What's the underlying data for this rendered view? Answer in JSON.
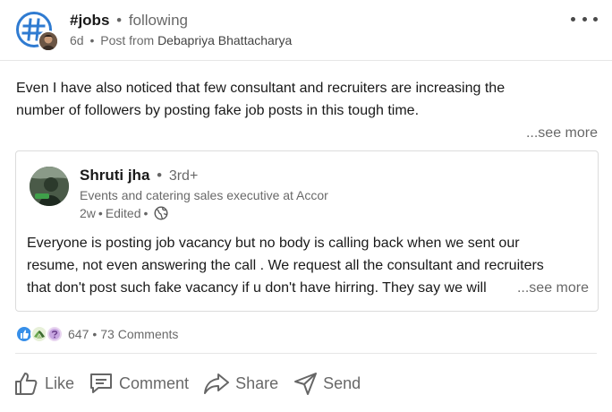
{
  "header": {
    "hashtag": "#jobs",
    "separator": "•",
    "follow_status": "following",
    "age": "6d",
    "post_from_label": "Post from",
    "poster_name": "Debapriya Bhattacharya"
  },
  "post": {
    "text_line1": "Even I have also noticed that few consultant and recruiters are increasing the",
    "text_line2": "number of followers by posting fake job posts in this tough time.",
    "see_more": "...see more"
  },
  "quoted_post": {
    "author_name": "Shruti jha",
    "degree": "3rd+",
    "headline": "Events and catering sales executive at Accor",
    "time": "2w",
    "edited": "Edited",
    "text_line1": "Everyone is posting job vacancy but no body is calling back when we sent our",
    "text_line2": "resume, not even answering the call . We request all the consultant and recruiters",
    "text_line3": "that don't post such fake vacancy if u don't have hirring. They say we will",
    "see_more": "...see more"
  },
  "social": {
    "reaction_icons": [
      "like-icon",
      "support-icon",
      "curious-icon"
    ],
    "reaction_count": "647",
    "comments": "73 Comments"
  },
  "actions": {
    "like": "Like",
    "comment": "Comment",
    "share": "Share",
    "send": "Send"
  },
  "colors": {
    "brand_blue": "#0a66c2",
    "like_blue": "#378fe9",
    "muted_text": "#666666"
  }
}
